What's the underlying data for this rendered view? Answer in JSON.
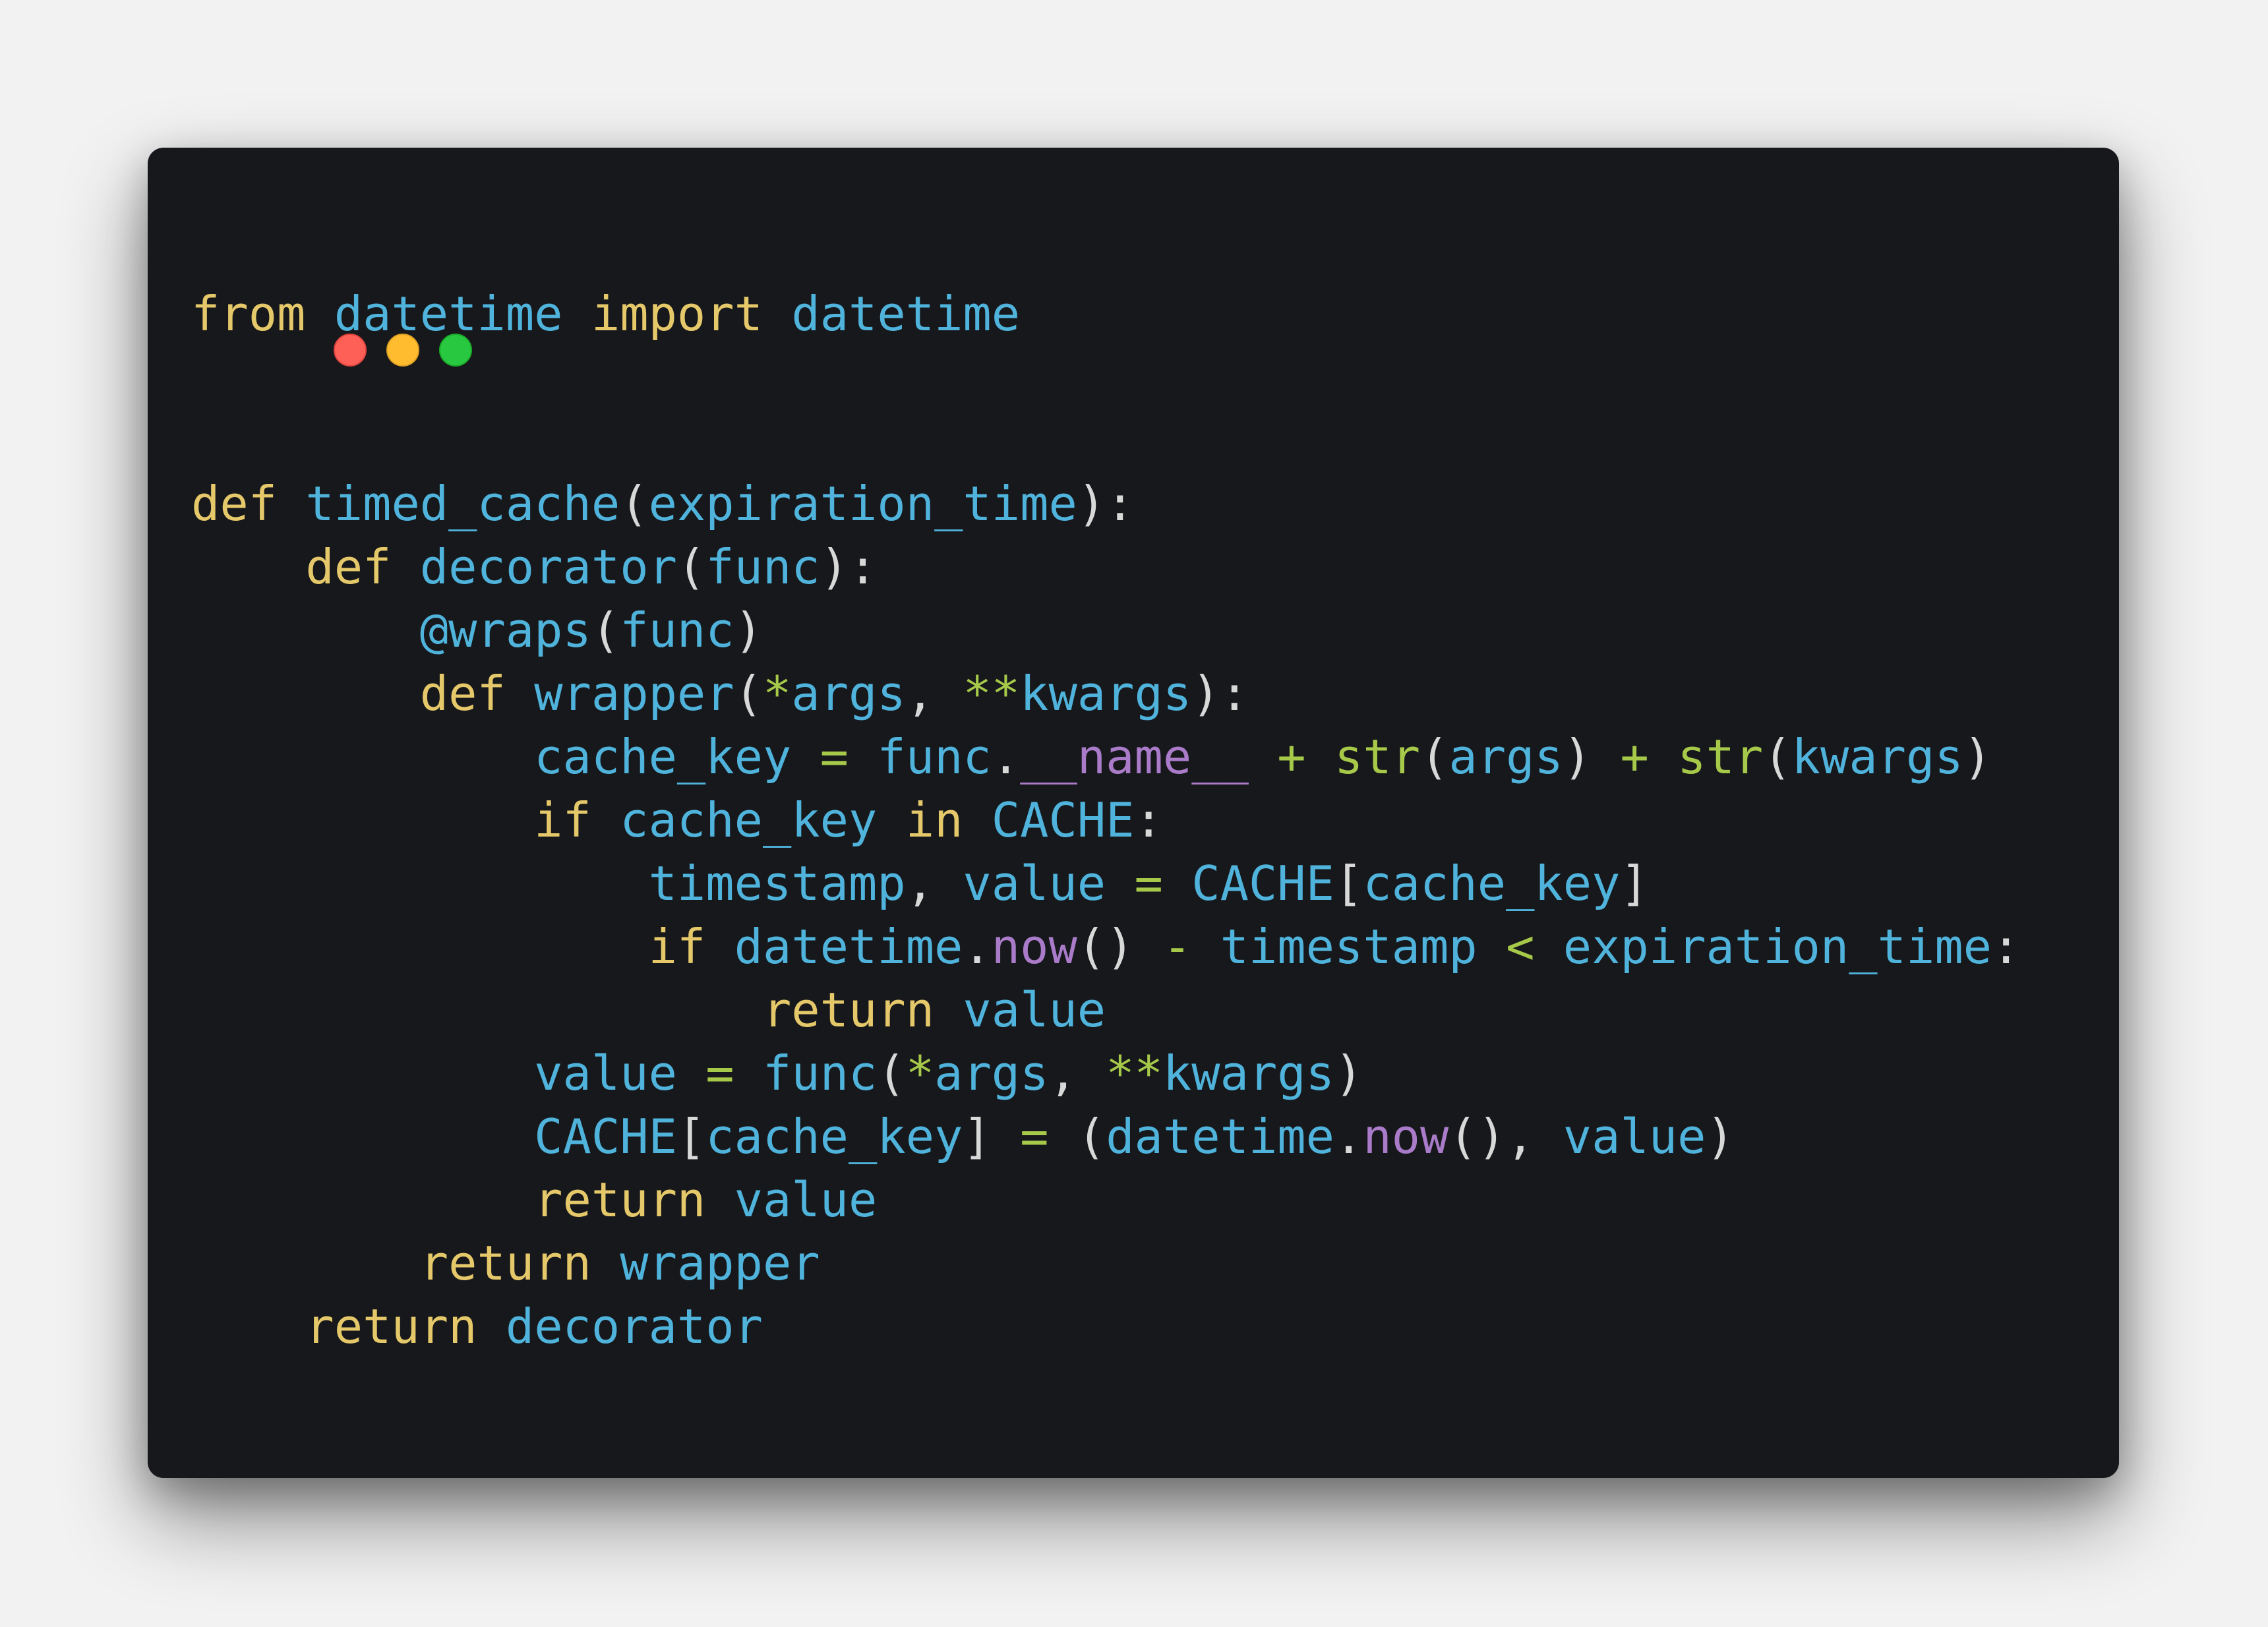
{
  "window": {
    "controls": [
      {
        "name": "close",
        "color": "#fe5f57",
        "border": "#e0443e"
      },
      {
        "name": "minimize",
        "color": "#febc2e",
        "border": "#dea123"
      },
      {
        "name": "maximize",
        "color": "#28c840",
        "border": "#1aab29"
      }
    ]
  },
  "code": {
    "language": "python",
    "lines": [
      [
        [
          "kw",
          "from"
        ],
        [
          "pu",
          " "
        ],
        [
          "id",
          "datetime"
        ],
        [
          "pu",
          " "
        ],
        [
          "kw",
          "import"
        ],
        [
          "pu",
          " "
        ],
        [
          "id",
          "datetime"
        ]
      ],
      [],
      [],
      [
        [
          "kw",
          "def"
        ],
        [
          "pu",
          " "
        ],
        [
          "id",
          "timed_cache"
        ],
        [
          "pu",
          "("
        ],
        [
          "id",
          "expiration_time"
        ],
        [
          "pu",
          "):"
        ]
      ],
      [
        [
          "pu",
          "    "
        ],
        [
          "kw",
          "def"
        ],
        [
          "pu",
          " "
        ],
        [
          "id",
          "decorator"
        ],
        [
          "pu",
          "("
        ],
        [
          "id",
          "func"
        ],
        [
          "pu",
          "):"
        ]
      ],
      [
        [
          "pu",
          "        "
        ],
        [
          "id",
          "@wraps"
        ],
        [
          "pu",
          "("
        ],
        [
          "id",
          "func"
        ],
        [
          "pu",
          ")"
        ]
      ],
      [
        [
          "pu",
          "        "
        ],
        [
          "kw",
          "def"
        ],
        [
          "pu",
          " "
        ],
        [
          "id",
          "wrapper"
        ],
        [
          "pu",
          "("
        ],
        [
          "op",
          "*"
        ],
        [
          "id",
          "args"
        ],
        [
          "pu",
          ", "
        ],
        [
          "op",
          "**"
        ],
        [
          "id",
          "kwargs"
        ],
        [
          "pu",
          "):"
        ]
      ],
      [
        [
          "pu",
          "            "
        ],
        [
          "id",
          "cache_key"
        ],
        [
          "pu",
          " "
        ],
        [
          "op",
          "="
        ],
        [
          "pu",
          " "
        ],
        [
          "id",
          "func"
        ],
        [
          "pu",
          "."
        ],
        [
          "sp",
          "__name__"
        ],
        [
          "pu",
          " "
        ],
        [
          "op",
          "+"
        ],
        [
          "pu",
          " "
        ],
        [
          "op",
          "str"
        ],
        [
          "pu",
          "("
        ],
        [
          "id",
          "args"
        ],
        [
          "pu",
          ") "
        ],
        [
          "op",
          "+"
        ],
        [
          "pu",
          " "
        ],
        [
          "op",
          "str"
        ],
        [
          "pu",
          "("
        ],
        [
          "id",
          "kwargs"
        ],
        [
          "pu",
          ")"
        ]
      ],
      [
        [
          "pu",
          "            "
        ],
        [
          "kw",
          "if"
        ],
        [
          "pu",
          " "
        ],
        [
          "id",
          "cache_key"
        ],
        [
          "pu",
          " "
        ],
        [
          "kw",
          "in"
        ],
        [
          "pu",
          " "
        ],
        [
          "id",
          "CACHE"
        ],
        [
          "pu",
          ":"
        ]
      ],
      [
        [
          "pu",
          "                "
        ],
        [
          "id",
          "timestamp"
        ],
        [
          "pu",
          ", "
        ],
        [
          "id",
          "value"
        ],
        [
          "pu",
          " "
        ],
        [
          "op",
          "="
        ],
        [
          "pu",
          " "
        ],
        [
          "id",
          "CACHE"
        ],
        [
          "pu",
          "["
        ],
        [
          "id",
          "cache_key"
        ],
        [
          "pu",
          "]"
        ]
      ],
      [
        [
          "pu",
          "                "
        ],
        [
          "kw",
          "if"
        ],
        [
          "pu",
          " "
        ],
        [
          "id",
          "datetime"
        ],
        [
          "pu",
          "."
        ],
        [
          "sp",
          "now"
        ],
        [
          "pu",
          "() "
        ],
        [
          "op",
          "-"
        ],
        [
          "pu",
          " "
        ],
        [
          "id",
          "timestamp"
        ],
        [
          "pu",
          " "
        ],
        [
          "op",
          "<"
        ],
        [
          "pu",
          " "
        ],
        [
          "id",
          "expiration_time"
        ],
        [
          "pu",
          ":"
        ]
      ],
      [
        [
          "pu",
          "                    "
        ],
        [
          "kw",
          "return"
        ],
        [
          "pu",
          " "
        ],
        [
          "id",
          "value"
        ]
      ],
      [
        [
          "pu",
          "            "
        ],
        [
          "id",
          "value"
        ],
        [
          "pu",
          " "
        ],
        [
          "op",
          "="
        ],
        [
          "pu",
          " "
        ],
        [
          "id",
          "func"
        ],
        [
          "pu",
          "("
        ],
        [
          "op",
          "*"
        ],
        [
          "id",
          "args"
        ],
        [
          "pu",
          ", "
        ],
        [
          "op",
          "**"
        ],
        [
          "id",
          "kwargs"
        ],
        [
          "pu",
          ")"
        ]
      ],
      [
        [
          "pu",
          "            "
        ],
        [
          "id",
          "CACHE"
        ],
        [
          "pu",
          "["
        ],
        [
          "id",
          "cache_key"
        ],
        [
          "pu",
          "] "
        ],
        [
          "op",
          "="
        ],
        [
          "pu",
          " ("
        ],
        [
          "id",
          "datetime"
        ],
        [
          "pu",
          "."
        ],
        [
          "sp",
          "now"
        ],
        [
          "pu",
          "(), "
        ],
        [
          "id",
          "value"
        ],
        [
          "pu",
          ")"
        ]
      ],
      [
        [
          "pu",
          "            "
        ],
        [
          "kw",
          "return"
        ],
        [
          "pu",
          " "
        ],
        [
          "id",
          "value"
        ]
      ],
      [
        [
          "pu",
          "        "
        ],
        [
          "kw",
          "return"
        ],
        [
          "pu",
          " "
        ],
        [
          "id",
          "wrapper"
        ]
      ],
      [
        [
          "pu",
          "    "
        ],
        [
          "kw",
          "return"
        ],
        [
          "pu",
          " "
        ],
        [
          "id",
          "decorator"
        ]
      ]
    ]
  }
}
